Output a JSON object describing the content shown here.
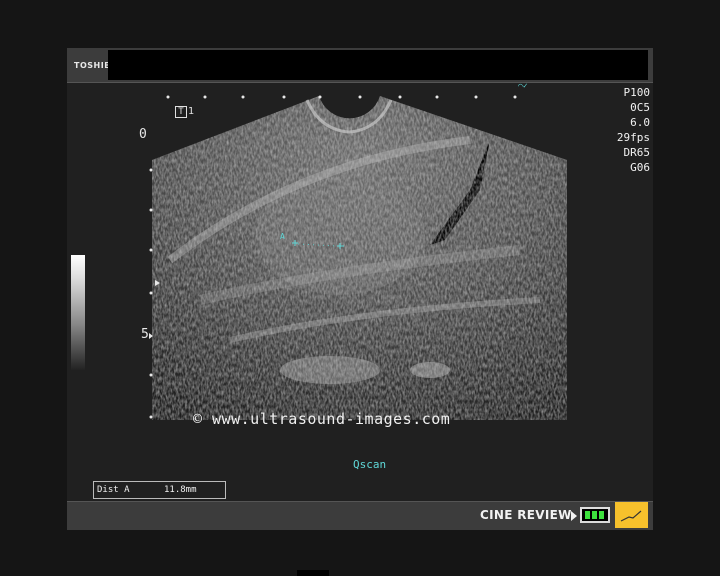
{
  "header": {
    "brand": "TOSHIBA"
  },
  "imaging_params": [
    "P100",
    "0C5",
    "6.0",
    "29fps",
    "DR65",
    "G06"
  ],
  "transducer_marker": {
    "box": "T",
    "num": "1"
  },
  "depth_scale": {
    "labels": [
      "0",
      "5"
    ]
  },
  "caliper": {
    "label": "A"
  },
  "watermark": "© www.ultrasound-images.com",
  "mode_label": "Qscan",
  "measurement": {
    "label": "Dist A",
    "value": "11.8mm"
  },
  "footer": {
    "cine_label": "CINE REVIEW"
  },
  "colors": {
    "accent_cyan": "#5fd7d7",
    "cine_tag": "#f7c12c",
    "battery_green": "#3ee23e"
  }
}
